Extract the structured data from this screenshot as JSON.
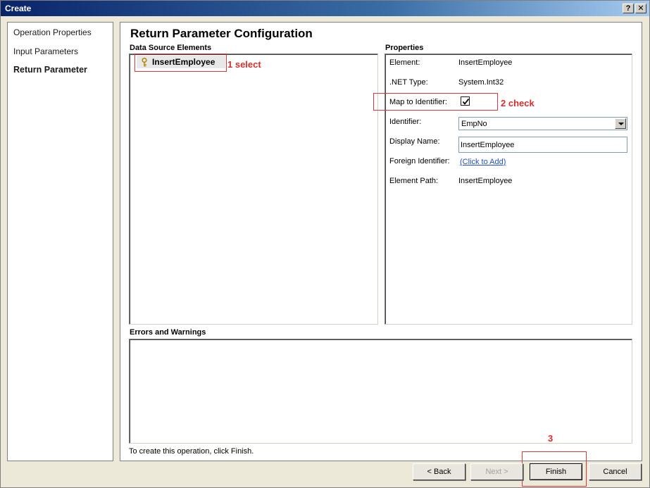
{
  "window": {
    "title": "Create",
    "help_glyph": "?",
    "close_glyph": "✕"
  },
  "nav": {
    "items": [
      {
        "label": "Operation Properties"
      },
      {
        "label": "Input Parameters"
      },
      {
        "label": "Return Parameter"
      }
    ],
    "active": "Return Parameter"
  },
  "main": {
    "title": "Return Parameter Configuration",
    "data_source_label": "Data Source Elements",
    "tree_node": "InsertEmployee",
    "properties_label": "Properties",
    "properties": {
      "element_label": "Element:",
      "element_value": "InsertEmployee",
      "net_type_label": ".NET Type:",
      "net_type_value": "System.Int32",
      "map_label": "Map to Identifier:",
      "map_checked": true,
      "identifier_label": "Identifier:",
      "identifier_value": "EmpNo",
      "display_name_label": "Display Name:",
      "display_name_value": "InsertEmployee",
      "foreign_label": "Foreign Identifier:",
      "foreign_link": "(Click to Add)",
      "path_label": "Element Path:",
      "path_value": "InsertEmployee"
    },
    "errors_label": "Errors and Warnings",
    "status": "To create this operation, click Finish."
  },
  "annotations": {
    "a1": "1 select",
    "a2": "2 check",
    "a3": "3",
    "color": "#d62d2d"
  },
  "buttons": {
    "back": "< Back",
    "next": "Next >",
    "finish": "Finish",
    "cancel": "Cancel"
  }
}
